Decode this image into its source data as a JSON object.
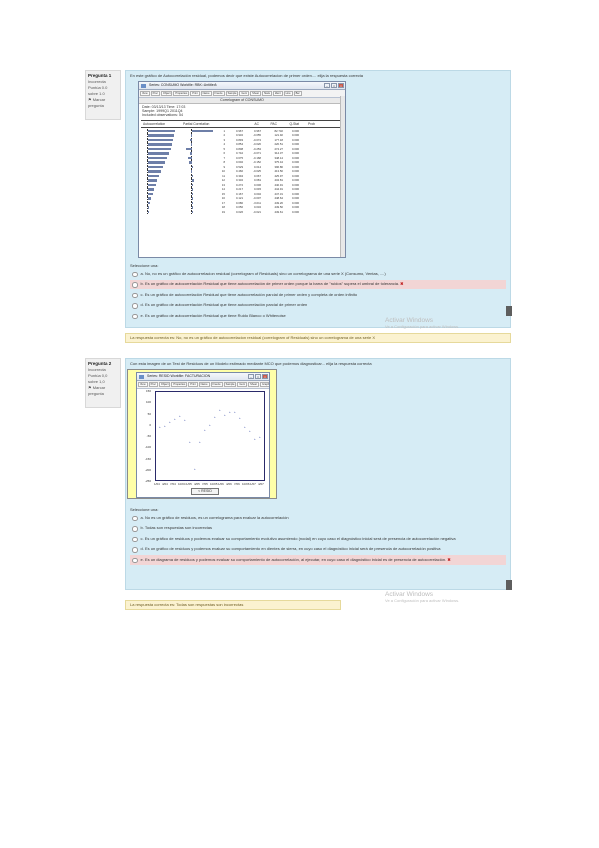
{
  "q1": {
    "info": {
      "label": "Pregunta",
      "number": "1",
      "status": "Incorrecta",
      "score": "Puntúa 0.0 sobre 1.0",
      "flag": "Marcar pregunta"
    },
    "text": "En este gráfico de Autocorrelación residual, podemos decir que existe Autocorrelacion de primer orden.... elija la respuesta correcta",
    "window": {
      "title": "Series: CONSUMO   Workfile: RBK::Untitled\\",
      "toolbar": [
        "View",
        "Proc",
        "Object",
        "Properties",
        "Print",
        "Name",
        "Freeze",
        "Sample",
        "Genr",
        "Sheet",
        "Stats",
        "Ident",
        "Line",
        "Bar"
      ],
      "subtitle": "Correlogram of CONSUMO",
      "meta": [
        "Date: 03/13/13   Time: 17:03",
        "Sample: 1999Q1 2011Q4",
        "Included observations: 54"
      ],
      "head": {
        "ac_graph": "Autocorrelation",
        "pac_graph": "Partial Correlation",
        "ac": "AC",
        "pac": "PAC",
        "q": "Q-Stat",
        "prob": "Prob"
      }
    },
    "correlogram": [
      {
        "lag": "1",
        "ac": "0.967",
        "pac": "0.967",
        "q": "82.732",
        "prob": "0.000",
        "ac_v": 0.967,
        "pac_v": 0.967
      },
      {
        "lag": "2",
        "ac": "0.932",
        "pac": "-0.055",
        "q": "121.92",
        "prob": "0.000",
        "ac_v": 0.932,
        "pac_v": -0.055
      },
      {
        "lag": "3",
        "ac": "0.893",
        "pac": "-0.074",
        "q": "177.18",
        "prob": "0.000",
        "ac_v": 0.893,
        "pac_v": -0.074
      },
      {
        "lag": "4",
        "ac": "0.854",
        "pac": "-0.026",
        "q": "220.51",
        "prob": "0.000",
        "ac_v": 0.854,
        "pac_v": -0.026
      },
      {
        "lag": "5",
        "ac": "0.808",
        "pac": "-0.253",
        "q": "274.27",
        "prob": "0.000",
        "ac_v": 0.808,
        "pac_v": -0.253
      },
      {
        "lag": "6",
        "ac": "0.742",
        "pac": "-0.071",
        "q": "314.37",
        "prob": "0.000",
        "ac_v": 0.742,
        "pac_v": -0.071
      },
      {
        "lag": "7",
        "ac": "0.675",
        "pac": "-0.168",
        "q": "348.14",
        "prob": "0.000",
        "ac_v": 0.675,
        "pac_v": -0.168
      },
      {
        "lag": "8",
        "ac": "0.602",
        "pac": "-0.152",
        "q": "375.44",
        "prob": "0.000",
        "ac_v": 0.602,
        "pac_v": -0.152
      },
      {
        "lag": "9",
        "ac": "0.529",
        "pac": "0.014",
        "q": "396.86",
        "prob": "0.000",
        "ac_v": 0.529,
        "pac_v": 0.014
      },
      {
        "lag": "10",
        "ac": "0.460",
        "pac": "-0.025",
        "q": "413.50",
        "prob": "0.000",
        "ac_v": 0.46,
        "pac_v": -0.025
      },
      {
        "lag": "11",
        "ac": "0.394",
        "pac": "0.067",
        "q": "425.97",
        "prob": "0.000",
        "ac_v": 0.394,
        "pac_v": 0.067
      },
      {
        "lag": "12",
        "ac": "0.332",
        "pac": "0.081",
        "q": "434.81",
        "prob": "0.000",
        "ac_v": 0.332,
        "pac_v": 0.081
      },
      {
        "lag": "13",
        "ac": "0.272",
        "pac": "0.006",
        "q": "440.91",
        "prob": "0.000",
        "ac_v": 0.272,
        "pac_v": 0.006
      },
      {
        "lag": "14",
        "ac": "0.217",
        "pac": "0.045",
        "q": "444.91",
        "prob": "0.000",
        "ac_v": 0.217,
        "pac_v": 0.045
      },
      {
        "lag": "15",
        "ac": "0.167",
        "pac": "0.002",
        "q": "447.31",
        "prob": "0.000",
        "ac_v": 0.167,
        "pac_v": 0.002
      },
      {
        "lag": "16",
        "ac": "0.121",
        "pac": "-0.007",
        "q": "448.64",
        "prob": "0.000",
        "ac_v": 0.121,
        "pac_v": -0.007
      },
      {
        "lag": "17",
        "ac": "0.080",
        "pac": "-0.011",
        "q": "449.26",
        "prob": "0.000",
        "ac_v": 0.08,
        "pac_v": -0.011
      },
      {
        "lag": "18",
        "ac": "0.050",
        "pac": "0.032",
        "q": "449.50",
        "prob": "0.000",
        "ac_v": 0.05,
        "pac_v": 0.032
      },
      {
        "lag": "19",
        "ac": "0.026",
        "pac": "-0.021",
        "q": "449.61",
        "prob": "0.000",
        "ac_v": 0.026,
        "pac_v": -0.021
      }
    ],
    "select_label": "Seleccione una:",
    "options": [
      "a. No, no es un gráfico de autocorrelacion residual (correlogram of Residuals) sino un correlograma de una serie X (Consumo, Ventas, ....)",
      "b. Es un gráfico de autocorrelación Residual que tiene autocorrelación de primer orden porque la barra de \"ruidos\" supera el umbral de tolerancia.",
      "c. Es un gráfico de autocorrelación Residual que tiene autocorrelación parcial de primer orden y completa de orden infinito",
      "d. Es un gráfico de autocorrelación Residual que tiene autocorrelación parcial de primer orden",
      "e. Es un gráfico de autocorrelación Residual que tiene Ruido Blanco o Whitenoise"
    ],
    "wrong_mark": "✖",
    "feedback": "La respuesta correcta es: No, no es un gráfico de autocorrelacion residual (correlogram of Residuals) sino un correlograma de una serie X",
    "watermark": {
      "title": "Activar Windows",
      "sub": "Ve a Configuración para activar Windows."
    }
  },
  "q2": {
    "info": {
      "label": "Pregunta",
      "number": "2",
      "status": "Incorrecta",
      "score": "Puntúa 0,0 sobre 1,0",
      "flag": "Marcar pregunta"
    },
    "text": "Con esta imagen de un Test de Residuos de un Modelo estimado mediante MCO que podemos diagnosticar... elija la respuesta correcta",
    "window": {
      "title": "Series: RESID   Workfile: FACTURACION",
      "toolbar": [
        "View",
        "Proc",
        "Object",
        "Properties",
        "Print",
        "Name",
        "Freeze",
        "Sample",
        "Genr",
        "Sheet",
        "Graph",
        "Stats",
        "Ident"
      ],
      "button": "< RESID"
    },
    "select_label": "Seleccione una:",
    "options": [
      "a. No es un gráfico de residuos, es un correlograma para evaluar la autocorrelación",
      "b. Todas son respuestas son incorrectas",
      "c. Es un gráfico de residuos y podemos evaluar su comportamiento evolutivo asumiendo (nodal) en cuyo caso el diagnóstico inicial será de presencia de autocorrelación negativa",
      "d. Es un gráfico de residuos y podemos evaluar su comportamiento en dientes de sierra, en cuyo caso el diagnóstico inicial será de presencia de autocorrelación positiva",
      "e. Es un diagrama de residuos y podemos evaluar su comportamiento de autocorrelación, al ejecutar, en cuyo caso el diagnóstico inicial es de presencia de autocorrelación."
    ],
    "wrong_mark": "✖",
    "feedback": "La respuesta correcta es: Todas son respuestas son incorrectas",
    "watermark": {
      "title": "Activar Windows",
      "sub": "Ve a Configuración para activar Windows."
    }
  },
  "chart_data": {
    "type": "scatter",
    "title": "",
    "xlabel": "",
    "ylabel": "",
    "x_ticks": [
      "1/04",
      "4/04",
      "7/04",
      "10/04",
      "1/05",
      "4/05",
      "7/05",
      "10/05",
      "1/06",
      "4/06",
      "7/06",
      "10/06",
      "1/07",
      "4/07"
    ],
    "y_ticks": [
      "150",
      "100",
      "50",
      "0",
      "-50",
      "-100",
      "-150",
      "-200",
      "-250"
    ],
    "ylim": [
      -250,
      150
    ],
    "x": [
      1,
      2,
      3,
      4,
      5,
      6,
      7,
      8,
      9,
      10,
      11,
      12,
      13,
      14,
      15,
      16,
      17,
      18,
      19,
      20,
      21
    ],
    "series": [
      {
        "values": [
          -5,
          0,
          15,
          30,
          45,
          25,
          -70,
          -190,
          -70,
          -20,
          5,
          40,
          70,
          50,
          60,
          60,
          35,
          -5,
          -25,
          -60,
          -50
        ]
      }
    ]
  }
}
